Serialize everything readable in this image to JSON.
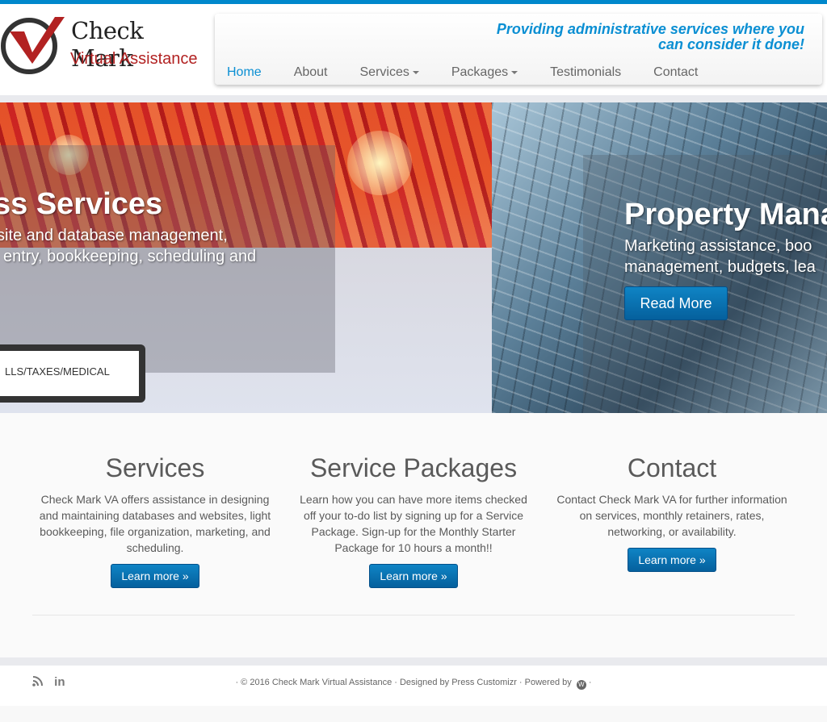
{
  "brand": {
    "name": "Check Mark",
    "subtitle": "Virtual Assistance",
    "accent": "#0088cc",
    "logo_red": "#b22222"
  },
  "header": {
    "tagline_line1": "Providing administrative services where you",
    "tagline_line2": "can consider it done!"
  },
  "nav": [
    {
      "label": "Home",
      "active": true
    },
    {
      "label": "About"
    },
    {
      "label": "Services",
      "dropdown": true
    },
    {
      "label": "Packages",
      "dropdown": true
    },
    {
      "label": "Testimonials"
    },
    {
      "label": "Contact"
    }
  ],
  "slider": {
    "left": {
      "title": "ss Services",
      "text1": "site and database management,",
      "text2": "entry, bookkeeping, scheduling and",
      "label": "LLS/TAXES/MEDICAL"
    },
    "right": {
      "title": "Property Mana",
      "text1": "Marketing assistance, boo",
      "text2": "management, budgets, lea",
      "button": "Read More"
    }
  },
  "features": [
    {
      "title": "Services",
      "text": "Check Mark VA offers assistance in designing and maintaining databases and websites, light bookkeeping, file organization, marketing, and scheduling.",
      "button": "Learn more »"
    },
    {
      "title": "Service Packages",
      "text": "Learn how you can have more items checked off your to-do list by signing up for a Service Package. Sign-up for the Monthly Starter Package for 10 hours a month!!",
      "button": "Learn more »"
    },
    {
      "title": "Contact",
      "text": "Contact Check Mark VA for further information on services, monthly retainers, rates, networking, or availability.",
      "button": "Learn more »"
    }
  ],
  "footer": {
    "credits": "· © 2016 Check Mark Virtual Assistance · Designed by Press Customizr · Powered by",
    "end": " ·",
    "social": [
      "rss-icon",
      "linkedin-icon"
    ],
    "linkedin": "in"
  }
}
